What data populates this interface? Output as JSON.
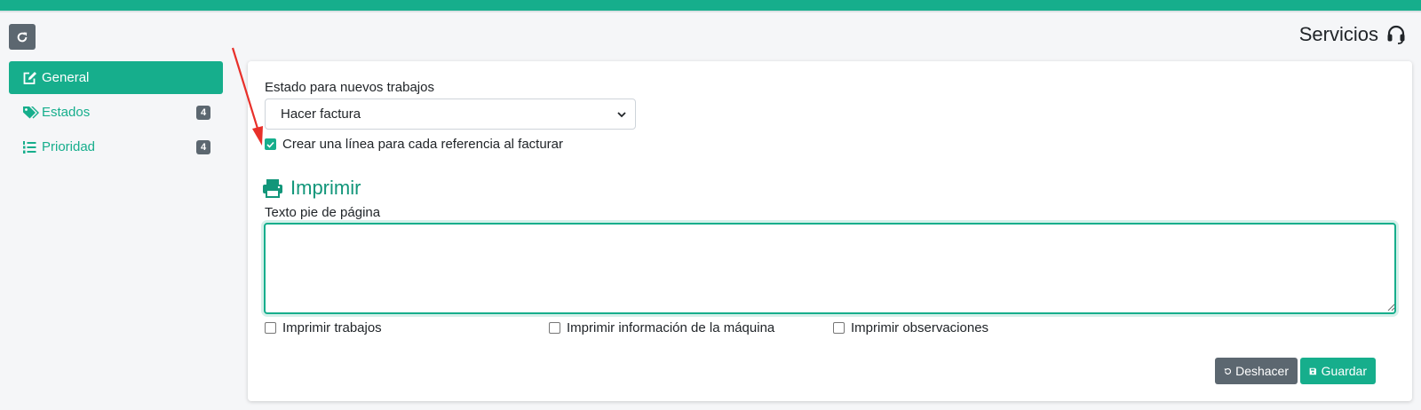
{
  "colors": {
    "accent": "#16ae8c",
    "secondary": "#5c6770",
    "annotation": "#e8302a"
  },
  "header": {
    "title": "Servicios",
    "title_icon": "headset-icon",
    "refresh_icon": "refresh-icon"
  },
  "sidebar": {
    "items": [
      {
        "label": "General",
        "icon": "edit-icon",
        "active": true
      },
      {
        "label": "Estados",
        "icon": "tags-icon",
        "badge": "4"
      },
      {
        "label": "Prioridad",
        "icon": "list-ol-icon",
        "badge": "4"
      }
    ]
  },
  "form": {
    "status_label": "Estado para nuevos trabajos",
    "status_value": "Hacer factura",
    "line_per_ref_label": "Crear una línea para cada referencia al facturar",
    "line_per_ref_checked": true,
    "print_section_title": "Imprimir",
    "footer_text_label": "Texto pie de página",
    "footer_text_value": "",
    "print_jobs_label": "Imprimir trabajos",
    "print_machine_label": "Imprimir información de la máquina",
    "print_notes_label": "Imprimir observaciones"
  },
  "actions": {
    "undo_label": "Deshacer",
    "save_label": "Guardar"
  }
}
